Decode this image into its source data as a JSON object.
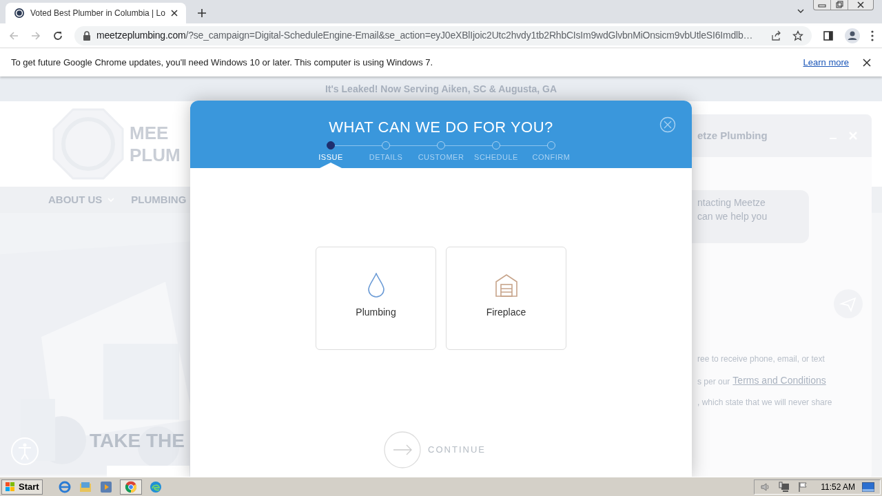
{
  "browser": {
    "tab": {
      "title": "Voted Best Plumber in Columbia | Lo"
    },
    "url": {
      "host": "meetzeplumbing.com",
      "rest": "/?se_campaign=Digital-ScheduleEngine-Email&se_action=eyJ0eXBlIjoic2Utc2hvdy1tb2RhbCIsIm9wdGlvbnMiOnsicm9vbUtleSI6Imdlb…"
    },
    "infobar": {
      "message": "To get future Google Chrome updates, you'll need Windows 10 or later. This computer is using Windows 7.",
      "link": "Learn more"
    }
  },
  "page": {
    "banner": "It's Leaked! Now Serving Aiken, SC & Augusta, GA",
    "logo_lines": [
      "MEE",
      "PLUM"
    ],
    "nav": [
      "ABOUT US",
      "PLUMBING"
    ],
    "hero_heading": "TAKE THE",
    "chat": {
      "title": "etze Plumbing",
      "message_lines": [
        "ntacting Meetze",
        "can we help you"
      ],
      "consent_lines": [
        "ree to receive phone, email, or text",
        "s per our",
        "Terms and Conditions",
        ", which state that we will never share"
      ]
    }
  },
  "modal": {
    "title": "WHAT CAN WE DO FOR YOU?",
    "steps": [
      {
        "label": "ISSUE",
        "selected": true
      },
      {
        "label": "DETAILS",
        "selected": false
      },
      {
        "label": "CUSTOMER",
        "selected": false
      },
      {
        "label": "SCHEDULE",
        "selected": false
      },
      {
        "label": "CONFIRM",
        "selected": false
      }
    ],
    "services": [
      {
        "label": "Plumbing",
        "kind": "drop"
      },
      {
        "label": "Fireplace",
        "kind": "fireplace"
      }
    ],
    "continue": "CONTINUE"
  },
  "taskbar": {
    "start": "Start",
    "clock": "11:52 AM"
  }
}
